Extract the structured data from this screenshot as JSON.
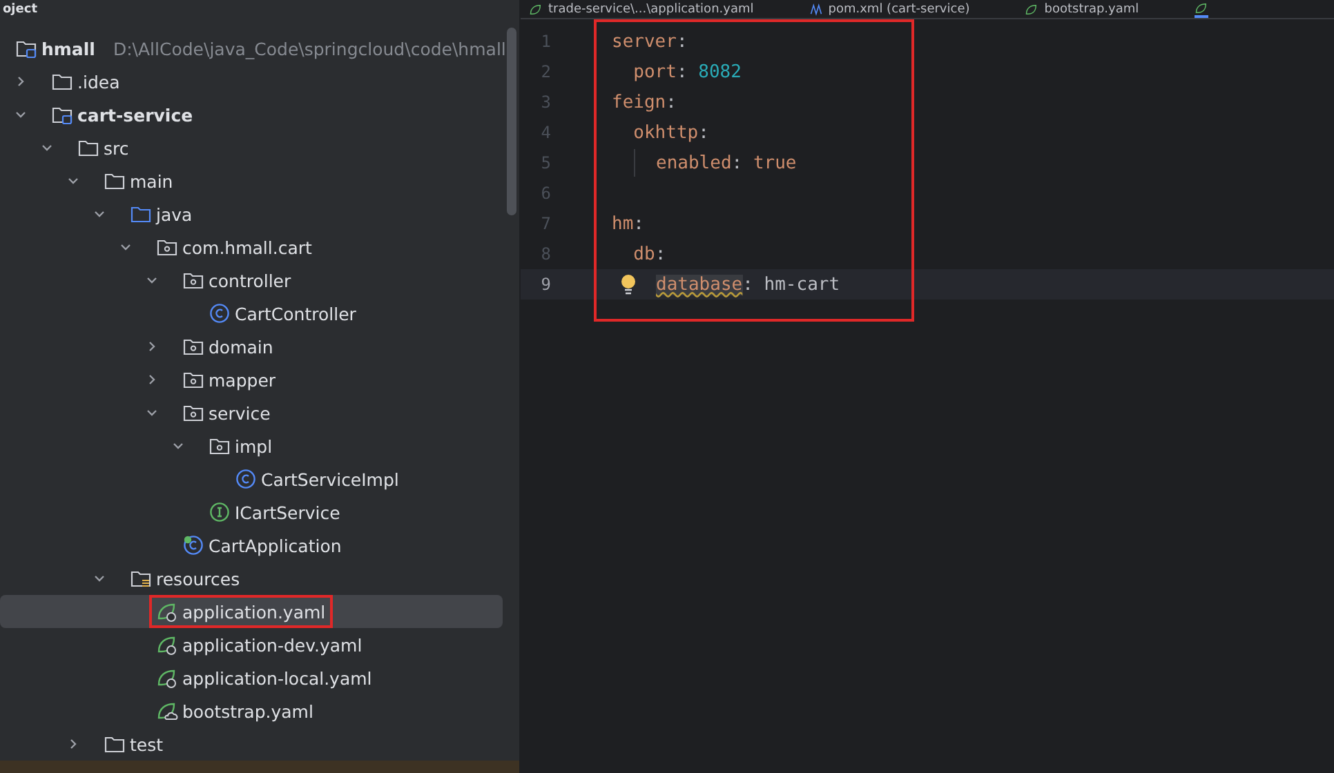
{
  "project_panel": {
    "title": "oject",
    "tree": [
      {
        "name": "hmall",
        "path": "D:\\AllCode\\java_Code\\springcloud\\code\\hmall",
        "kind": "module",
        "bold": true,
        "selected": false,
        "highlighted": false,
        "children": [
          {
            "name": ".idea",
            "kind": "folder",
            "expanded": false,
            "bold": false,
            "selected": false,
            "highlighted": false
          },
          {
            "name": "cart-service",
            "kind": "module",
            "expanded": true,
            "bold": true,
            "selected": false,
            "highlighted": false,
            "children": [
              {
                "name": "src",
                "kind": "folder",
                "expanded": true,
                "bold": false,
                "selected": false,
                "highlighted": false,
                "children": [
                  {
                    "name": "main",
                    "kind": "folder",
                    "expanded": true,
                    "bold": false,
                    "selected": false,
                    "highlighted": false,
                    "children": [
                      {
                        "name": "java",
                        "kind": "source-folder",
                        "expanded": true,
                        "bold": false,
                        "selected": false,
                        "highlighted": false,
                        "children": [
                          {
                            "name": "com.hmall.cart",
                            "kind": "package",
                            "expanded": true,
                            "bold": false,
                            "selected": false,
                            "highlighted": false,
                            "children": [
                              {
                                "name": "controller",
                                "kind": "package",
                                "expanded": true,
                                "bold": false,
                                "selected": false,
                                "highlighted": false,
                                "children": [
                                  {
                                    "name": "CartController",
                                    "kind": "class",
                                    "bold": false,
                                    "selected": false,
                                    "highlighted": false
                                  }
                                ]
                              },
                              {
                                "name": "domain",
                                "kind": "package",
                                "expanded": false,
                                "bold": false,
                                "selected": false,
                                "highlighted": false
                              },
                              {
                                "name": "mapper",
                                "kind": "package",
                                "expanded": false,
                                "bold": false,
                                "selected": false,
                                "highlighted": false
                              },
                              {
                                "name": "service",
                                "kind": "package",
                                "expanded": true,
                                "bold": false,
                                "selected": false,
                                "highlighted": false,
                                "children": [
                                  {
                                    "name": "impl",
                                    "kind": "package",
                                    "expanded": true,
                                    "bold": false,
                                    "selected": false,
                                    "highlighted": false,
                                    "children": [
                                      {
                                        "name": "CartServiceImpl",
                                        "kind": "class",
                                        "bold": false,
                                        "selected": false,
                                        "highlighted": false
                                      }
                                    ]
                                  },
                                  {
                                    "name": "ICartService",
                                    "kind": "interface",
                                    "bold": false,
                                    "selected": false,
                                    "highlighted": false
                                  }
                                ]
                              },
                              {
                                "name": "CartApplication",
                                "kind": "spring-class",
                                "bold": false,
                                "selected": false,
                                "highlighted": false
                              }
                            ]
                          }
                        ]
                      },
                      {
                        "name": "resources",
                        "kind": "resources-folder",
                        "expanded": true,
                        "bold": false,
                        "selected": false,
                        "highlighted": false,
                        "children": [
                          {
                            "name": "application.yaml",
                            "kind": "spring-yaml",
                            "bold": false,
                            "selected": true,
                            "highlighted": true
                          },
                          {
                            "name": "application-dev.yaml",
                            "kind": "spring-yaml",
                            "bold": false,
                            "selected": false,
                            "highlighted": false
                          },
                          {
                            "name": "application-local.yaml",
                            "kind": "spring-yaml",
                            "bold": false,
                            "selected": false,
                            "highlighted": false
                          },
                          {
                            "name": "bootstrap.yaml",
                            "kind": "bootstrap-yaml",
                            "bold": false,
                            "selected": false,
                            "highlighted": false
                          }
                        ]
                      }
                    ]
                  },
                  {
                    "name": "test",
                    "kind": "folder",
                    "expanded": false,
                    "bold": false,
                    "selected": false,
                    "highlighted": false
                  }
                ]
              }
            ]
          }
        ]
      }
    ]
  },
  "editor": {
    "tabs": [
      {
        "label": "trade-service\\...\\application.yaml",
        "kind": "spring-yaml",
        "selected": false
      },
      {
        "label": "pom.xml (cart-service)",
        "kind": "maven",
        "selected": false
      },
      {
        "label": "bootstrap.yaml",
        "kind": "bootstrap-yaml",
        "selected": false
      },
      {
        "kind": "spring-yaml",
        "selected": true
      }
    ],
    "highlight_box": true,
    "lines": [
      {
        "number": "1",
        "current": false,
        "guide": false,
        "bulb": false,
        "tokens": [
          {
            "kind": "key",
            "text": "server",
            "warn": false
          },
          {
            "kind": "punct",
            "text": ":"
          }
        ]
      },
      {
        "number": "2",
        "current": false,
        "guide": false,
        "bulb": false,
        "tokens": [
          {
            "kind": "key",
            "text": "  port",
            "warn": false
          },
          {
            "kind": "punct",
            "text": ": "
          },
          {
            "kind": "number",
            "text": "8082"
          }
        ]
      },
      {
        "number": "3",
        "current": false,
        "guide": false,
        "bulb": false,
        "tokens": [
          {
            "kind": "key",
            "text": "feign",
            "warn": false
          },
          {
            "kind": "punct",
            "text": ":"
          }
        ]
      },
      {
        "number": "4",
        "current": false,
        "guide": false,
        "bulb": false,
        "tokens": [
          {
            "kind": "key",
            "text": "  okhttp",
            "warn": false
          },
          {
            "kind": "punct",
            "text": ":"
          }
        ]
      },
      {
        "number": "5",
        "current": false,
        "guide": true,
        "bulb": false,
        "tokens": [
          {
            "kind": "key",
            "text": "enabled",
            "warn": false
          },
          {
            "kind": "punct",
            "text": ": "
          },
          {
            "kind": "keyword",
            "text": "true"
          }
        ]
      },
      {
        "number": "6",
        "current": false,
        "guide": false,
        "bulb": false
      },
      {
        "number": "7",
        "current": false,
        "guide": false,
        "bulb": false,
        "tokens": [
          {
            "kind": "key",
            "text": "hm",
            "warn": false
          },
          {
            "kind": "punct",
            "text": ":"
          }
        ]
      },
      {
        "number": "8",
        "current": false,
        "guide": false,
        "bulb": false,
        "tokens": [
          {
            "kind": "key",
            "text": "  db",
            "warn": false
          },
          {
            "kind": "punct",
            "text": ":"
          }
        ]
      },
      {
        "number": "9",
        "current": true,
        "guide": false,
        "bulb": true,
        "tokens": [
          {
            "kind": "key",
            "text": "database",
            "warn": true
          },
          {
            "kind": "punct",
            "text": ": "
          },
          {
            "kind": "plain",
            "text": "hm-cart"
          }
        ]
      }
    ]
  }
}
